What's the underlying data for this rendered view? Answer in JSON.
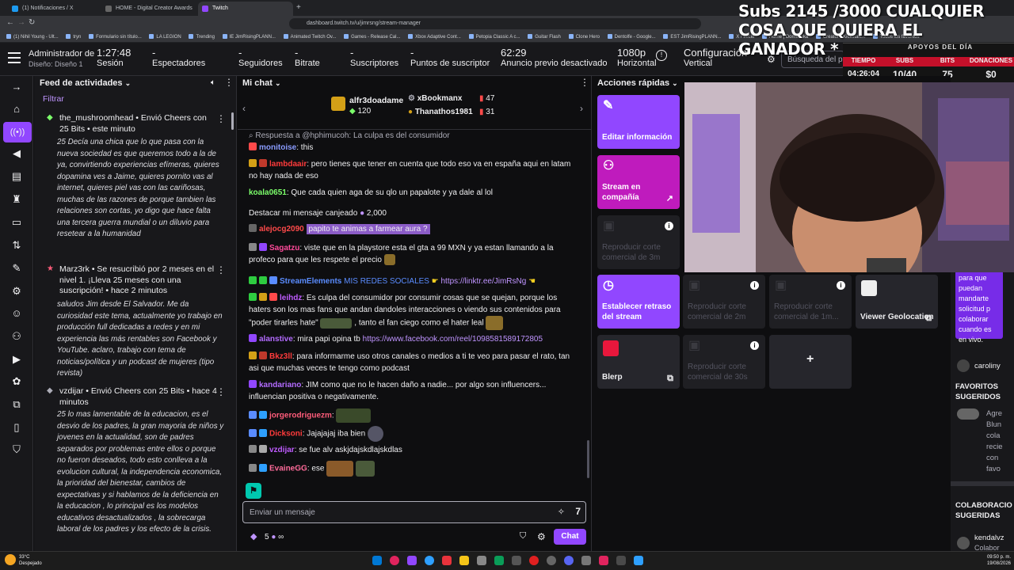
{
  "browser": {
    "tabs": [
      {
        "label": "(1) Notificaciones / X",
        "color": "#1d9bf0"
      },
      {
        "label": "HOME - Digital Creator Awards",
        "color": "#555"
      },
      {
        "label": "Twitch",
        "color": "#9147ff"
      }
    ],
    "url": "dashboard.twitch.tv/u/jimrsng/stream-manager",
    "bookmarks": [
      "(1) Nihil Young - Ult...",
      "tryn",
      "Formulario sin título...",
      "LA LEGION",
      "Trending",
      "IE JimRisingPLANN...",
      "Animated Twitch Ov...",
      "Games - Release Cal...",
      "Xbox Adaptive Cont...",
      "Petopia Classic A c...",
      "Guitar Flash",
      "Clone Hero",
      "Dentolfe - Google...",
      "EST JimRisingPLANN...",
      "X / Inicio",
      "Home | Domestika",
      "Creator - Kickstart...",
      "Todos los favoritos"
    ]
  },
  "overlay": {
    "title": "Subs 2145 /3000 CUALQUIER COSA QUE QUIERA EL GANADOR *",
    "apoyos_label": "APOYOS DEL DÍA",
    "cols": [
      {
        "label": "TIEMPO",
        "value": "04:26:04"
      },
      {
        "label": "SUBS",
        "value": "10/40"
      },
      {
        "label": "BITS",
        "value": "75"
      },
      {
        "label": "DONACIONES",
        "value": "$0"
      }
    ]
  },
  "header": {
    "role": "Administrador de",
    "layout": "Diseño: Diseño 1",
    "stats": [
      {
        "value": "1:27:48",
        "label": "Sesión"
      },
      {
        "value": "-",
        "label": "Espectadores"
      },
      {
        "value": "-",
        "label": "Seguidores"
      },
      {
        "value": "-",
        "label": "Bitrate"
      },
      {
        "value": "-",
        "label": "Suscriptores"
      },
      {
        "value": "-",
        "label": "Puntos de suscriptor"
      },
      {
        "value": "62:29",
        "label": "Anuncio previo desactivado"
      },
      {
        "value": "1080p",
        "label": "Horizontal"
      },
      {
        "value": "Configuración",
        "label": "Vertical"
      }
    ],
    "search_placeholder": "Búsqueda del p"
  },
  "feed": {
    "title": "Feed de actividades",
    "filter": "Filtrar",
    "items": [
      {
        "head": "the_mushroomhead • Envió Cheers con 25 Bits • este minuto",
        "body": "25 Decía una chica que lo que pasa con la nueva sociedad es que queremos todo a la de ya, convirtiendo experiencias efímeras, quieres dopamina ves a Jaime, quieres pornito vas al internet, quieres piel vas con las cariñosas, muchas de las razones de porque tambien las relaciones son cortas, yo digo que hace falta una tercera guerra mundial o un diluvio para resetear a la humanidad"
      },
      {
        "head": "Marz3rk • Se resucribió por 2 meses en el nivel 1. ¡Lleva 25 meses con una suscripción! • hace 2 minutos",
        "body": "saludos Jim desde El Salvador. Me da curiosidad este tema, actualmente yo trabajo en producción full dedicadas a redes y en mi experiencia las más rentables son Facebook y YouTube. aclaro, trabajo con tema de noticias/política y un podcast de mujeres (tipo revista)"
      },
      {
        "head": "vzdijar • Envió Cheers con 25 Bits • hace 4 minutos",
        "body": "25 lo mas lamentable de la educacion, es el desvio de los padres, la gran mayoria de niños y jovenes en la actualidad, son de padres separados por problemas entre ellos o porque no fueron deseados, todo esto conlleva a la evolucion cultural, la independencia economica, la prioridad del bienestar, cambios de expectativas y si hablamos de la deficiencia en la educacion , lo principal es los modelos educativos desactualizados , la sobrecarga laboral de los padres y los efecto de la crisis."
      }
    ]
  },
  "chat": {
    "title": "Mi chat",
    "leaders": [
      {
        "name": "alfr3doadame",
        "value": "120"
      },
      {
        "name": "xBookmanx",
        "value": "47"
      },
      {
        "name": "Thanathos1981",
        "value": "31"
      }
    ],
    "messages": [
      {
        "user": "",
        "text": "Respuesta a @hphimucoh: La culpa es del consumidor",
        "color": "#adadb8"
      },
      {
        "user": "monitoise",
        "text": ": this",
        "color": "#8a9cff"
      },
      {
        "user": "lambdaair",
        "text": ": pero tienes que tener en cuenta que todo eso va en españa aqui en latam no hay nada de eso",
        "color": "#ff3b3b"
      },
      {
        "user": "koala0651",
        "text": ": Que cada quien aga de su qlo un papalote y ya dale al lol",
        "color": "#7cff6b"
      },
      {
        "user": "",
        "text": "Destacar mi mensaje canjeado",
        "color": "#efeff1",
        "points": "2,000"
      },
      {
        "user": "alejocg2090",
        "text": "papito te animas a farmear aura ?",
        "color": "#ff4a4a"
      },
      {
        "user": "Sagatzu",
        "text": ": viste que en la playstore esta el gta a 99 MXN y ya estan llamando a la profeco para que les respete el precio",
        "color": "#ff4a9a"
      },
      {
        "user": "StreamElements",
        "text": "MIS REDES SOCIALES",
        "color": "#5a8cff",
        "link": "https://linktr.ee/JimRsNg"
      },
      {
        "user": "leihdz",
        "text": ": Es culpa del consumidor por consumir cosas que se quejan, porque los haters son los mas fans que andan dandoles interacciones o viendo sus contenidos para \"poder tirarles hate\"",
        "color": "#bf5cff",
        "tail": ", tanto el fan ciego como el hater leal"
      },
      {
        "user": "alanstive",
        "text": ": mira papi opina tb",
        "color": "#b36bff",
        "link": "https://www.facebook.com/reel/1098581589172805"
      },
      {
        "user": "Bkz3ll",
        "text": ": para informarme uso otros canales o medios a ti te veo para pasar el rato, tan asi que muchas veces te tengo como podcast",
        "color": "#ff3b3b"
      },
      {
        "user": "kandariano",
        "text": ": JIM como que no le hacen daño a nadie... por algo son influencers... influencian positiva o negativamente.",
        "color": "#b36bff"
      },
      {
        "user": "jorgerodriguezm",
        "text": ":",
        "color": "#ff5c7a"
      },
      {
        "user": "Dicksoni",
        "text": ": Jajajajaj iba bien",
        "color": "#ff3b3b"
      },
      {
        "user": "vzdijar",
        "text": ": se fue alv askjdajskdlajskdlas",
        "color": "#bf5cff"
      },
      {
        "user": "EvaineGG",
        "text": ": ese",
        "color": "#ff6b9a"
      }
    ],
    "input_placeholder": "Enviar un mensaje",
    "points": "5",
    "send_label": "Chat"
  },
  "quick": {
    "title": "Acciones rápidas",
    "actions": [
      {
        "label": "Editar información",
        "style": "purple"
      },
      {
        "label": "Stream en compañía",
        "style": "magenta"
      },
      {
        "label": "Reproducir corte comercial de 3m",
        "style": "gray"
      },
      {
        "label": "Establecer retraso del stream",
        "style": "purple"
      },
      {
        "label": "Reproducir corte comercial de 2m",
        "style": "gray"
      },
      {
        "label": "Reproducir corte comercial de 1m...",
        "style": "gray"
      },
      {
        "label": "Viewer Geolocation",
        "style": "gray2"
      },
      {
        "label": "Blerp",
        "style": "gray2"
      },
      {
        "label": "Reproducir corte comercial de 30s",
        "style": "gray"
      }
    ]
  },
  "rightpanel": {
    "promo": "para que puedan mandarte solicitud p colaborar cuando es en vivo.",
    "user1": "caroliny",
    "fav_title": "FAVORITOS SUGERIDOS",
    "fav_text": "Agre Blun cola recie con favo",
    "collab_title": "COLABORACIO SUGERIDAS",
    "user2": "kendalvz",
    "user2_sub": "Colabor"
  },
  "taskbar": {
    "weather": "33°C",
    "weather_sub": "Despejado",
    "time": "09:50 p. m.",
    "date": "19/08/2026"
  }
}
